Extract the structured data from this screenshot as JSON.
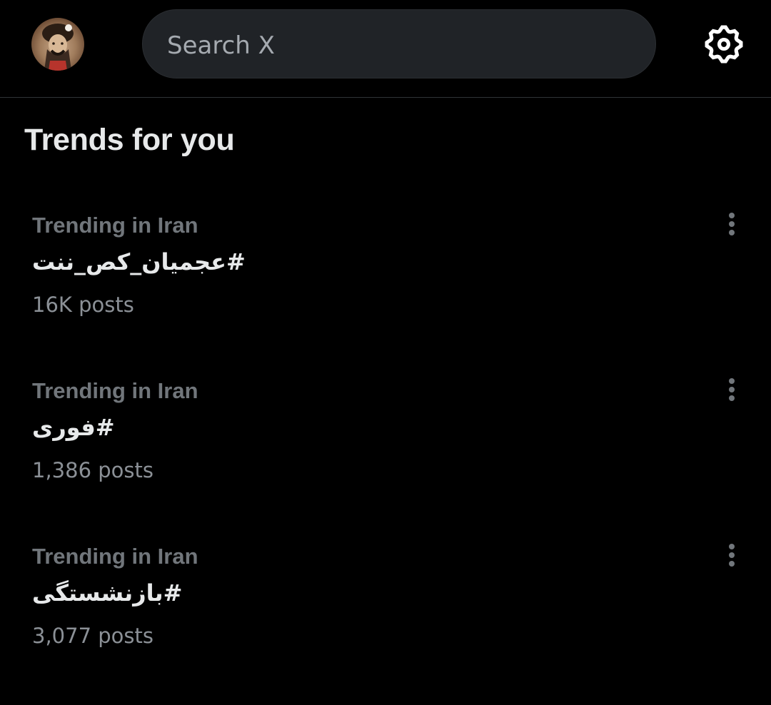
{
  "search": {
    "placeholder": "Search X"
  },
  "section": {
    "title": "Trends for you"
  },
  "trends": [
    {
      "context": "Trending in Iran",
      "tag": "#عجمیان_کص_ننت",
      "count": "16K posts"
    },
    {
      "context": "Trending in Iran",
      "tag": "#فوری",
      "count": "1,386 posts"
    },
    {
      "context": "Trending in Iran",
      "tag": "#بازنشستگی",
      "count": "3,077 posts"
    }
  ],
  "colors": {
    "background": "#000000",
    "text": "#e7e9ea",
    "muted": "#71767b",
    "search_bg": "#202327",
    "divider": "#2f3336"
  },
  "icons": {
    "settings": "gear-icon",
    "more": "more-vertical-icon"
  }
}
